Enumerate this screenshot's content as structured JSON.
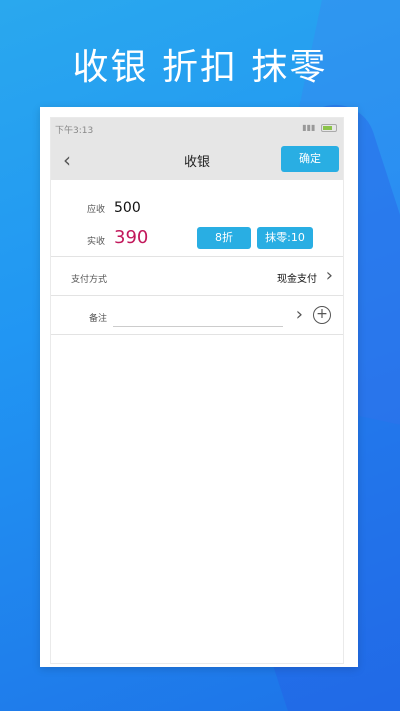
{
  "headline": "收银 折扣 抹零",
  "status": {
    "time": "下午3:13",
    "signal": "ᵢₗₗ ☁"
  },
  "nav": {
    "back_icon": "chevron-left-icon",
    "title": "收银",
    "confirm_label": "确定"
  },
  "due": {
    "label": "应收",
    "value": "500"
  },
  "paid": {
    "label": "实收",
    "value": "390"
  },
  "discount_button": "8折",
  "round_off_button": "抹零:10",
  "payment": {
    "label": "支付方式",
    "value": "现金支付"
  },
  "note": {
    "label": "备注",
    "value": ""
  },
  "colors": {
    "accent": "#29aee3",
    "paid_color": "#c2185b",
    "bg_blue": "#2196f3"
  }
}
